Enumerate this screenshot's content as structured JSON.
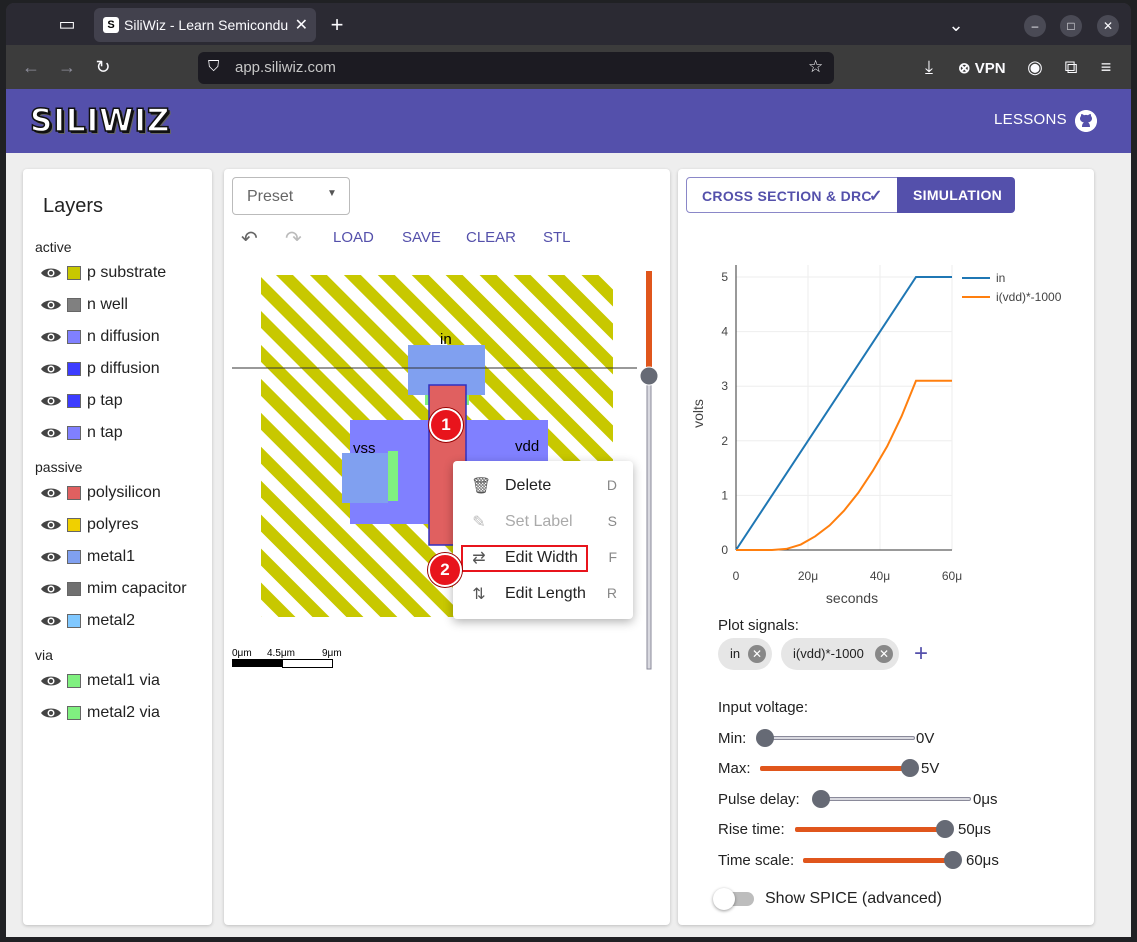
{
  "browser": {
    "tab_title": "SiliWiz - Learn Semicondu",
    "favicon_letter": "S",
    "url": "app.siliwiz.com",
    "vpn_label": "VPN"
  },
  "header": {
    "logo": "SILIWIZ",
    "lessons": "LESSONS"
  },
  "layers": {
    "title": "Layers",
    "groups": [
      {
        "name": "active",
        "items": [
          {
            "label": "p substrate",
            "color": "#c8c800"
          },
          {
            "label": "n well",
            "color": "#808080"
          },
          {
            "label": "n diffusion",
            "color": "#8080ff"
          },
          {
            "label": "p diffusion",
            "color": "#3c3cff"
          },
          {
            "label": "p tap",
            "color": "#3c3cff"
          },
          {
            "label": "n tap",
            "color": "#8080ff"
          }
        ]
      },
      {
        "name": "passive",
        "items": [
          {
            "label": "polysilicon",
            "color": "#e06060"
          },
          {
            "label": "polyres",
            "color": "#f0d000"
          },
          {
            "label": "metal1",
            "color": "#80a0f0"
          },
          {
            "label": "mim capacitor",
            "color": "#707070"
          },
          {
            "label": "metal2",
            "color": "#80c8ff"
          }
        ]
      },
      {
        "name": "via",
        "items": [
          {
            "label": "metal1 via",
            "color": "#80f080"
          },
          {
            "label": "metal2 via",
            "color": "#80f080"
          }
        ]
      }
    ]
  },
  "toolbar": {
    "preset": "Preset",
    "load": "LOAD",
    "save": "SAVE",
    "clear": "CLEAR",
    "stl": "STL"
  },
  "layout": {
    "label_in": "in",
    "label_vss": "vss",
    "label_vdd": "vdd",
    "scale": {
      "t0": "0μm",
      "t1": "4.5μm",
      "t2": "9μm"
    }
  },
  "context_menu": {
    "items": [
      {
        "label": "Delete",
        "key": "D",
        "enabled": true
      },
      {
        "label": "Set Label",
        "key": "S",
        "enabled": false
      },
      {
        "label": "Edit Width",
        "key": "F",
        "enabled": true
      },
      {
        "label": "Edit Length",
        "key": "R",
        "enabled": true
      }
    ]
  },
  "markers": [
    "1",
    "2"
  ],
  "sim_tabs": {
    "cross_section": "CROSS SECTION & DRC",
    "simulation": "SIMULATION"
  },
  "chart_data": {
    "type": "line",
    "xlabel": "seconds",
    "ylabel": "volts",
    "xlim": [
      0,
      60
    ],
    "ylim": [
      0,
      5
    ],
    "x_ticks": [
      "0",
      "20μ",
      "40μ",
      "60μ"
    ],
    "y_ticks": [
      "0",
      "1",
      "2",
      "3",
      "4",
      "5"
    ],
    "grid": true,
    "legend_position": "top-right",
    "series": [
      {
        "name": "in",
        "color": "#1f77b4",
        "x": [
          0,
          50,
          60
        ],
        "y": [
          0,
          5,
          5
        ]
      },
      {
        "name": "i(vdd)*-1000",
        "color": "#ff7f0e",
        "x": [
          0,
          10,
          14,
          18,
          22,
          26,
          30,
          34,
          38,
          42,
          46,
          50,
          60
        ],
        "y": [
          0,
          0,
          0.02,
          0.1,
          0.25,
          0.45,
          0.72,
          1.05,
          1.45,
          1.9,
          2.45,
          3.1,
          3.1
        ]
      }
    ]
  },
  "plot_signals": {
    "label": "Plot signals:",
    "signals": [
      "in",
      "i(vdd)*-1000"
    ],
    "add": "+"
  },
  "input_voltage": {
    "title": "Input voltage:",
    "sliders": [
      {
        "label": "Min:",
        "value": "0V",
        "fraction": 0.0
      },
      {
        "label": "Max:",
        "value": "5V",
        "fraction": 1.0
      },
      {
        "label": "Pulse delay:",
        "value": "0μs",
        "fraction": 0.0
      },
      {
        "label": "Rise time:",
        "value": "50μs",
        "fraction": 1.0
      },
      {
        "label": "Time scale:",
        "value": "60μs",
        "fraction": 1.0
      }
    ]
  },
  "spice_toggle": {
    "label": "Show SPICE (advanced)",
    "on": false
  }
}
